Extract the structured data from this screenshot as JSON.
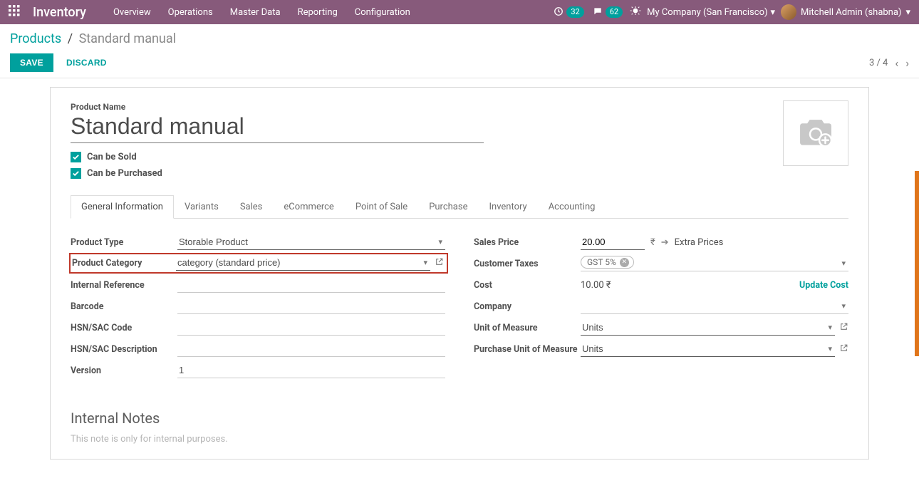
{
  "navbar": {
    "app_name": "Inventory",
    "menu": [
      "Overview",
      "Operations",
      "Master Data",
      "Reporting",
      "Configuration"
    ],
    "activities_badge": "32",
    "messages_badge": "62",
    "company": "My Company (San Francisco)",
    "user_name": "Mitchell Admin (shabna)"
  },
  "breadcrumb": {
    "root": "Products",
    "current": "Standard manual"
  },
  "buttons": {
    "save": "SAVE",
    "discard": "DISCARD"
  },
  "pager": {
    "text": "3 / 4"
  },
  "product": {
    "name_label": "Product Name",
    "name": "Standard manual",
    "can_be_sold_label": "Can be Sold",
    "can_be_purchased_label": "Can be Purchased"
  },
  "tabs": [
    "General Information",
    "Variants",
    "Sales",
    "eCommerce",
    "Point of Sale",
    "Purchase",
    "Inventory",
    "Accounting"
  ],
  "left": {
    "product_type": {
      "label": "Product Type",
      "value": "Storable Product"
    },
    "product_category": {
      "label": "Product Category",
      "value": "category (standard price)"
    },
    "internal_reference": {
      "label": "Internal Reference",
      "value": ""
    },
    "barcode": {
      "label": "Barcode",
      "value": ""
    },
    "hsn_code": {
      "label": "HSN/SAC Code",
      "value": ""
    },
    "hsn_desc": {
      "label": "HSN/SAC Description",
      "value": ""
    },
    "version": {
      "label": "Version",
      "value": "1"
    }
  },
  "right": {
    "sales_price": {
      "label": "Sales Price",
      "value": "20.00",
      "currency": "₹",
      "extra_prices": "Extra Prices"
    },
    "customer_taxes": {
      "label": "Customer Taxes",
      "tag": "GST 5%"
    },
    "cost": {
      "label": "Cost",
      "value": "10.00 ₹",
      "update": "Update Cost"
    },
    "company": {
      "label": "Company",
      "value": ""
    },
    "uom": {
      "label": "Unit of Measure",
      "value": "Units"
    },
    "purchase_uom": {
      "label": "Purchase Unit of Measure",
      "value": "Units"
    }
  },
  "notes": {
    "heading": "Internal Notes",
    "placeholder": "This note is only for internal purposes."
  }
}
